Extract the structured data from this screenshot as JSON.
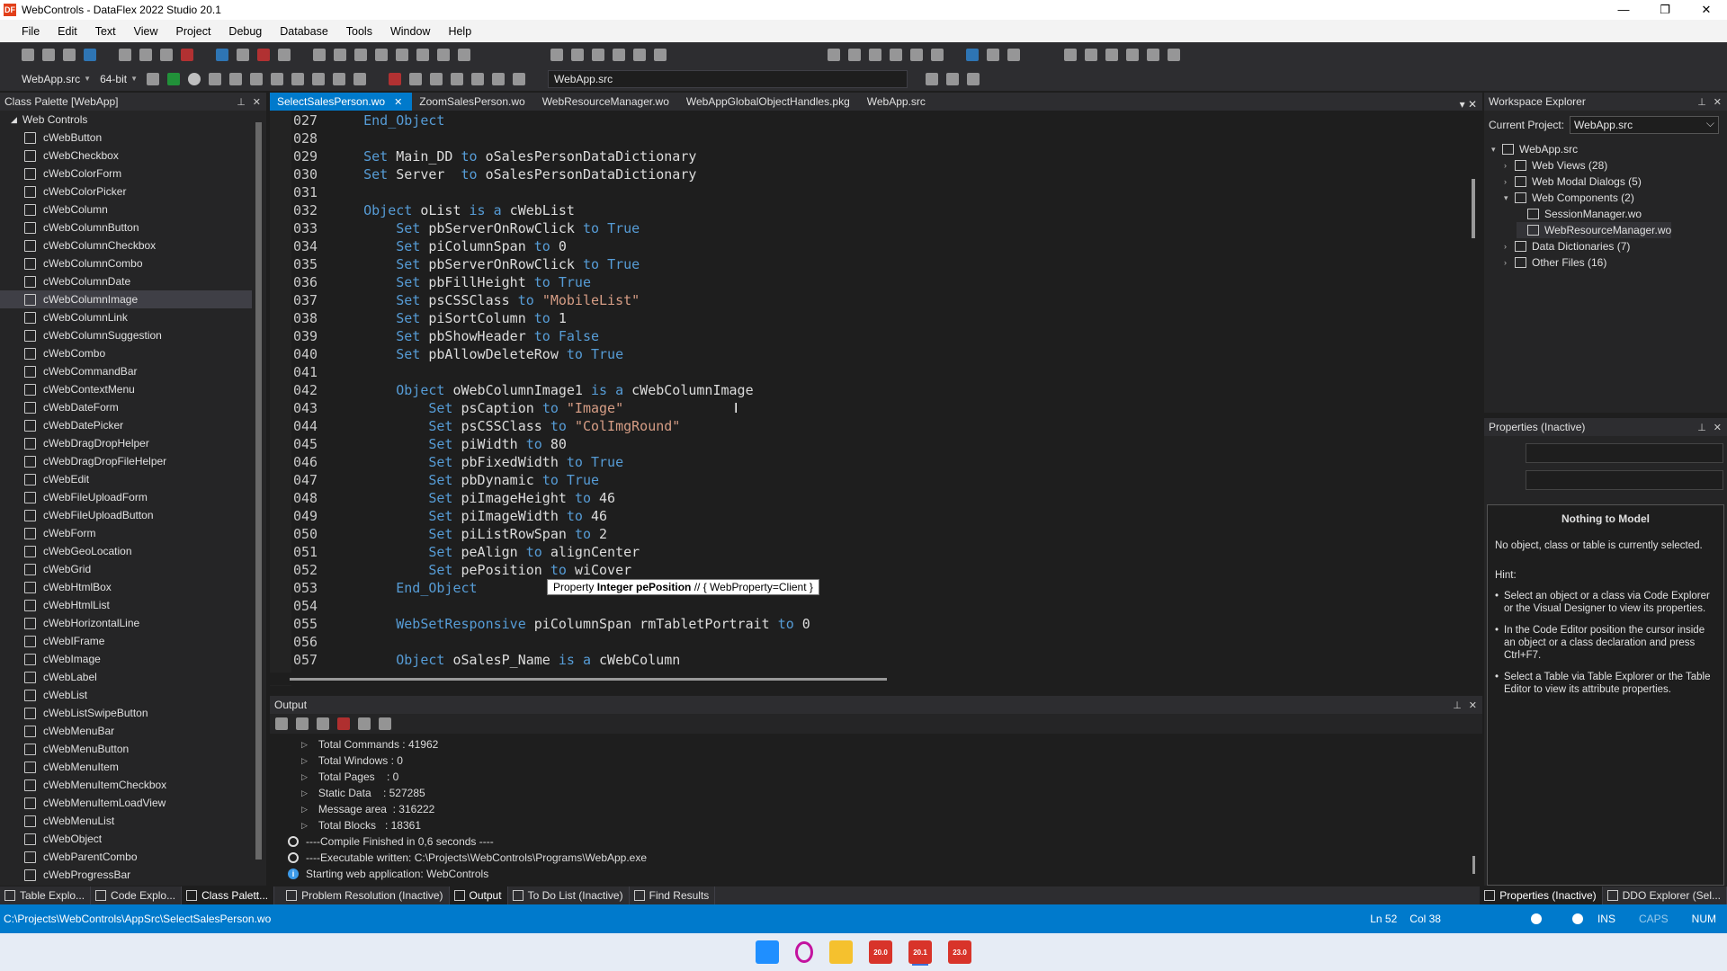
{
  "window": {
    "title": "WebControls - DataFlex 2022 Studio 20.1",
    "app_icon_text": "DF"
  },
  "menu": [
    "File",
    "Edit",
    "Text",
    "View",
    "Project",
    "Debug",
    "Database",
    "Tools",
    "Window",
    "Help"
  ],
  "toolbar": {
    "project": "WebApp.src",
    "platform": "64-bit",
    "file_combo": "WebApp.src"
  },
  "class_palette": {
    "title": "Class Palette [WebApp]",
    "group": "Web Controls",
    "selected": "cWebColumnImage",
    "items": [
      "cWebButton",
      "cWebCheckbox",
      "cWebColorForm",
      "cWebColorPicker",
      "cWebColumn",
      "cWebColumnButton",
      "cWebColumnCheckbox",
      "cWebColumnCombo",
      "cWebColumnDate",
      "cWebColumnImage",
      "cWebColumnLink",
      "cWebColumnSuggestion",
      "cWebCombo",
      "cWebCommandBar",
      "cWebContextMenu",
      "cWebDateForm",
      "cWebDatePicker",
      "cWebDragDropHelper",
      "cWebDragDropFileHelper",
      "cWebEdit",
      "cWebFileUploadForm",
      "cWebFileUploadButton",
      "cWebForm",
      "cWebGeoLocation",
      "cWebGrid",
      "cWebHtmlBox",
      "cWebHtmlList",
      "cWebHorizontalLine",
      "cWebIFrame",
      "cWebImage",
      "cWebLabel",
      "cWebList",
      "cWebListSwipeButton",
      "cWebMenuBar",
      "cWebMenuButton",
      "cWebMenuItem",
      "cWebMenuItemCheckbox",
      "cWebMenuItemLoadView",
      "cWebMenuList",
      "cWebObject",
      "cWebParentCombo",
      "cWebProgressBar"
    ]
  },
  "editor": {
    "tabs": [
      "SelectSalesPerson.wo",
      "ZoomSalesPerson.wo",
      "WebResourceManager.wo",
      "WebAppGlobalObjectHandles.pkg",
      "WebApp.src"
    ],
    "active_tab": 0,
    "lines": [
      {
        "n": "027",
        "indent": 1,
        "code": "End_Object"
      },
      {
        "n": "028",
        "indent": 0,
        "code": ""
      },
      {
        "n": "029",
        "indent": 1,
        "code": "Set Main_DD to oSalesPersonDataDictionary"
      },
      {
        "n": "030",
        "indent": 1,
        "code": "Set Server  to oSalesPersonDataDictionary"
      },
      {
        "n": "031",
        "indent": 0,
        "code": ""
      },
      {
        "n": "032",
        "indent": 1,
        "code": "Object oList is a cWebList"
      },
      {
        "n": "033",
        "indent": 2,
        "code": "Set pbServerOnRowClick to True"
      },
      {
        "n": "034",
        "indent": 2,
        "code": "Set piColumnSpan to 0"
      },
      {
        "n": "035",
        "indent": 2,
        "code": "Set pbServerOnRowClick to True"
      },
      {
        "n": "036",
        "indent": 2,
        "code": "Set pbFillHeight to True"
      },
      {
        "n": "037",
        "indent": 2,
        "code": "Set psCSSClass to \"MobileList\""
      },
      {
        "n": "038",
        "indent": 2,
        "code": "Set piSortColumn to 1"
      },
      {
        "n": "039",
        "indent": 2,
        "code": "Set pbShowHeader to False"
      },
      {
        "n": "040",
        "indent": 2,
        "code": "Set pbAllowDeleteRow to True"
      },
      {
        "n": "041",
        "indent": 0,
        "code": ""
      },
      {
        "n": "042",
        "indent": 2,
        "code": "Object oWebColumnImage1 is a cWebColumnImage"
      },
      {
        "n": "043",
        "indent": 3,
        "code": "Set psCaption to \"Image\""
      },
      {
        "n": "044",
        "indent": 3,
        "code": "Set psCSSClass to \"ColImgRound\""
      },
      {
        "n": "045",
        "indent": 3,
        "code": "Set piWidth to 80"
      },
      {
        "n": "046",
        "indent": 3,
        "code": "Set pbFixedWidth to True"
      },
      {
        "n": "047",
        "indent": 3,
        "code": "Set pbDynamic to True"
      },
      {
        "n": "048",
        "indent": 3,
        "code": "Set piImageHeight to 46"
      },
      {
        "n": "049",
        "indent": 3,
        "code": "Set piImageWidth to 46"
      },
      {
        "n": "050",
        "indent": 3,
        "code": "Set piListRowSpan to 2"
      },
      {
        "n": "051",
        "indent": 3,
        "code": "Set peAlign to alignCenter"
      },
      {
        "n": "052",
        "indent": 3,
        "code": "Set pePosition to wiCover"
      },
      {
        "n": "053",
        "indent": 2,
        "code": "End_Object"
      },
      {
        "n": "054",
        "indent": 0,
        "code": ""
      },
      {
        "n": "055",
        "indent": 2,
        "code": "WebSetResponsive piColumnSpan rmTabletPortrait to 0"
      },
      {
        "n": "056",
        "indent": 0,
        "code": ""
      },
      {
        "n": "057",
        "indent": 2,
        "code": "Object oSalesP_Name is a cWebColumn"
      }
    ],
    "tooltip": {
      "prefix": "Property ",
      "bold": "Integer pePosition",
      "suffix": " // { WebProperty=Client }"
    }
  },
  "output": {
    "title": "Output",
    "stats": [
      "Total Commands : 41962",
      "Total Windows : 0",
      "Total Pages    : 0",
      "Static Data    : 527285",
      "Message area  : 316222",
      "Total Blocks   : 18361"
    ],
    "messages": [
      {
        "kind": "circle",
        "text": "----Compile Finished in 0,6 seconds ----"
      },
      {
        "kind": "circle",
        "text": "----Executable written: C:\\Projects\\WebControls\\Programs\\WebApp.exe"
      },
      {
        "kind": "info",
        "text": "Starting web application: WebControls"
      }
    ]
  },
  "workspace": {
    "title": "Workspace Explorer",
    "current_project_label": "Current Project:",
    "current_project": "WebApp.src",
    "tree": [
      {
        "label": "WebApp.src",
        "level": 0,
        "expander": "▾"
      },
      {
        "label": "Web Views (28)",
        "level": 1,
        "expander": "›"
      },
      {
        "label": "Web Modal Dialogs (5)",
        "level": 1,
        "expander": "›"
      },
      {
        "label": "Web Components (2)",
        "level": 1,
        "expander": "▾"
      },
      {
        "label": "SessionManager.wo",
        "level": 2,
        "expander": ""
      },
      {
        "label": "WebResourceManager.wo",
        "level": 2,
        "expander": ""
      },
      {
        "label": "Data Dictionaries (7)",
        "level": 1,
        "expander": "›"
      },
      {
        "label": "Other Files (16)",
        "level": 1,
        "expander": "›"
      }
    ]
  },
  "properties": {
    "title": "Properties (Inactive)",
    "heading": "Nothing to Model",
    "message": "No object, class or table is currently selected.",
    "hint_label": "Hint:",
    "hints": [
      "Select an object or a class via Code Explorer or the Visual Designer to view its properties.",
      "In the Code Editor position the cursor inside an object or a class declaration and press Ctrl+F7.",
      "Select a Table via Table Explorer or the Table Editor to view its attribute properties."
    ]
  },
  "bottom_tabs_left": [
    "Table Explo...",
    "Code Explo...",
    "Class Palett..."
  ],
  "bottom_tabs_mid": [
    "Problem Resolution (Inactive)",
    "Output",
    "To Do List (Inactive)",
    "Find Results"
  ],
  "bottom_tabs_right": [
    "Properties (Inactive)",
    "DDO Explorer (Sel..."
  ],
  "status": {
    "path": "C:\\Projects\\WebControls\\AppSrc\\SelectSalesPerson.wo",
    "ln": "Ln 52",
    "col": "Col 38",
    "ins": "INS",
    "caps": "CAPS",
    "num": "NUM"
  },
  "taskbar": {
    "apps": [
      "20.0",
      "20.1",
      "23.0"
    ]
  }
}
